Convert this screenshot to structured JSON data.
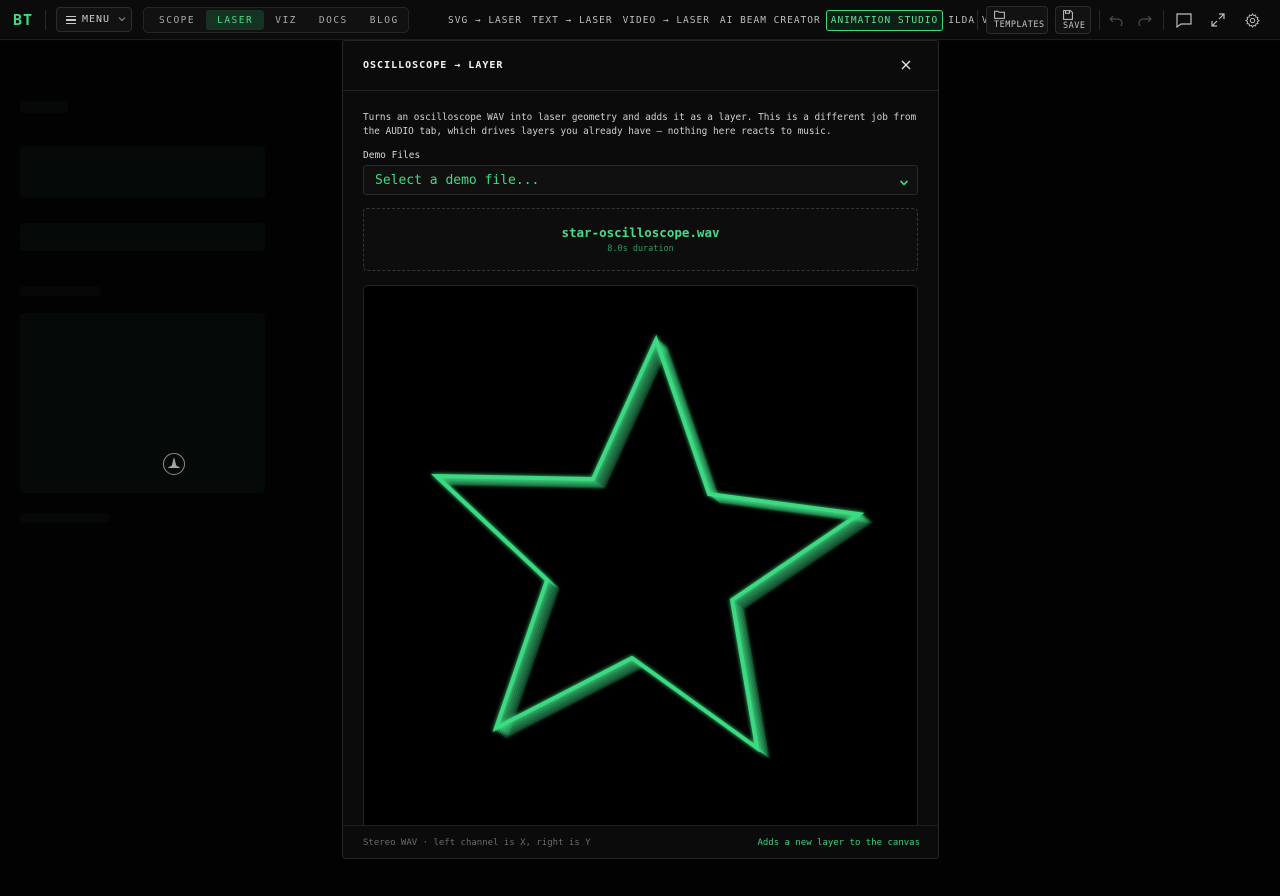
{
  "app": {
    "logo": "BT"
  },
  "header": {
    "menu_label": "MENU",
    "modes": [
      {
        "label": "SCOPE",
        "active": false
      },
      {
        "label": "LASER",
        "active": true
      },
      {
        "label": "VIZ",
        "active": false
      },
      {
        "label": "DOCS",
        "active": false
      },
      {
        "label": "BLOG",
        "active": false
      }
    ],
    "tools": [
      {
        "label": "SVG → LASER",
        "highlighted": false
      },
      {
        "label": "TEXT → LASER",
        "highlighted": false
      },
      {
        "label": "VIDEO → LASER",
        "highlighted": false
      },
      {
        "label": "AI BEAM CREATOR",
        "highlighted": false
      },
      {
        "label": "ANIMATION STUDIO",
        "highlighted": true
      },
      {
        "label": "ILDA VIEWER",
        "highlighted": false
      }
    ],
    "templates_label": "TEMPLATES",
    "save_label": "SAVE"
  },
  "modal": {
    "title": "OSCILLOSCOPE → LAYER",
    "description": "Turns an oscilloscope WAV into laser geometry and adds it as a layer. This is a different job from the AUDIO tab, which drives layers you already have — nothing here reacts to music.",
    "demo_label": "Demo Files",
    "select_placeholder": "Select a demo file...",
    "file": {
      "name": "star-oscilloscope.wav",
      "duration": "8.0s duration"
    },
    "footer_left": "Stereo WAV · left channel is X, right is Y",
    "footer_right": "Adds a new layer to the canvas"
  },
  "colors": {
    "accent": "#3ddc84",
    "background": "#050505",
    "panel": "#0b0b0b"
  },
  "icons": [
    "menu-icon",
    "chevron-down-icon",
    "folder-icon",
    "save-icon",
    "undo-icon",
    "redo-icon",
    "chat-icon",
    "expand-icon",
    "gear-icon",
    "close-icon",
    "compass-icon"
  ]
}
